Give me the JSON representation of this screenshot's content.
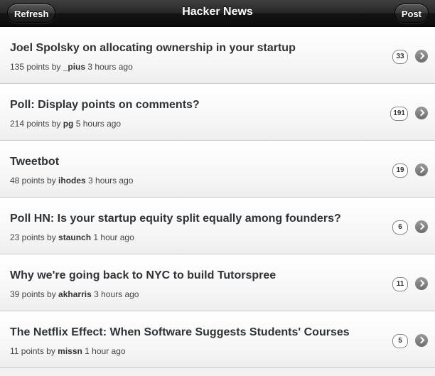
{
  "navbar": {
    "title": "Hacker News",
    "left_button": "Refresh",
    "right_button": "Post"
  },
  "icons": {
    "disclosure": "chevron-right-icon"
  },
  "stories": [
    {
      "title": "Joel Spolsky on allocating ownership in your startup",
      "points": "135 points by ",
      "user": "_pius",
      "age": " 3 hours ago",
      "comments": "33"
    },
    {
      "title": "Poll: Display points on comments?",
      "points": "214 points by ",
      "user": "pg",
      "age": " 5 hours ago",
      "comments": "191"
    },
    {
      "title": "Tweetbot",
      "points": "48 points by ",
      "user": "ihodes",
      "age": " 3 hours ago",
      "comments": "19"
    },
    {
      "title": "Poll HN: Is your startup equity split equally among founders?",
      "points": "23 points by ",
      "user": "staunch",
      "age": " 1 hour ago",
      "comments": "6"
    },
    {
      "title": "Why we're going back to NYC to build Tutorspree",
      "points": "39 points by ",
      "user": "akharris",
      "age": " 3 hours ago",
      "comments": "11"
    },
    {
      "title": "The Netflix Effect: When Software Suggests Students' Courses",
      "points": "11 points by ",
      "user": "missn",
      "age": " 1 hour ago",
      "comments": "5"
    }
  ]
}
